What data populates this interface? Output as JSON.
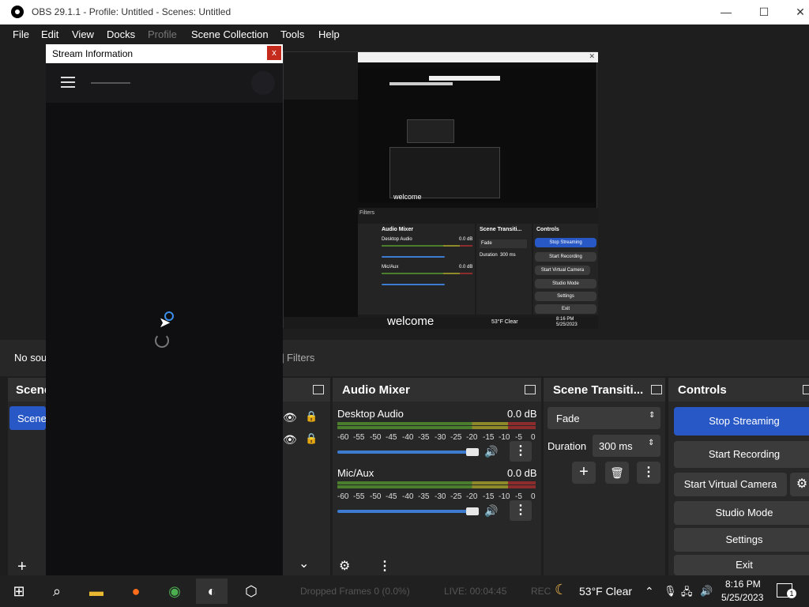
{
  "window": {
    "title": "OBS 29.1.1 - Profile: Untitled - Scenes: Untitled",
    "min": "—",
    "max": "☐",
    "close": "✕"
  },
  "menu": {
    "file": "File",
    "edit": "Edit",
    "view": "View",
    "docks": "Docks",
    "profile": "Profile",
    "scene_collection": "Scene Collection",
    "tools": "Tools",
    "help": "Help"
  },
  "preview": {
    "welcome": "welcome",
    "mini_audio_mixer": "Audio Mixer",
    "mini_scene_trans": "Scene Transiti...",
    "mini_controls": "Controls",
    "mini_desktop_audio": "Desktop Audio",
    "mini_mic": "Mic/Aux",
    "mini_db": "0.0 dB",
    "mini_fade": "Fade",
    "mini_duration": "Duration",
    "mini_ms": "300 ms",
    "mini_stop": "Stop Streaming",
    "mini_start_rec": "Start Recording",
    "mini_virtual": "Start Virtual Camera",
    "mini_studio": "Studio Mode",
    "mini_settings": "Settings",
    "mini_exit": "Exit",
    "mini_filters": "Filters",
    "mini_weather": "53°F Clear",
    "mini_time": "8:16 PM",
    "mini_date": "5/25/2023"
  },
  "sources_bar": {
    "no_source": "No sou",
    "filters": "Filters"
  },
  "scenes": {
    "title": "Scene",
    "item": "Scene"
  },
  "audio_mixer": {
    "title": "Audio Mixer",
    "tracks": [
      {
        "name": "Desktop Audio",
        "db": "0.0 dB",
        "volume": 1.0
      },
      {
        "name": "Mic/Aux",
        "db": "0.0 dB",
        "volume": 1.0
      }
    ],
    "ticks": [
      "-60",
      "-55",
      "-50",
      "-45",
      "-40",
      "-35",
      "-30",
      "-25",
      "-20",
      "-15",
      "-10",
      "-5",
      "0"
    ]
  },
  "scene_transitions": {
    "title": "Scene Transiti...",
    "transition": "Fade",
    "duration_label": "Duration",
    "duration_value": "300 ms"
  },
  "controls": {
    "title": "Controls",
    "stop_streaming": "Stop Streaming",
    "start_recording": "Start Recording",
    "start_virtual_camera": "Start Virtual Camera",
    "studio_mode": "Studio Mode",
    "settings": "Settings",
    "exit": "Exit"
  },
  "status": {
    "dropped": "Dropped Frames 0 (0.0%)",
    "live": "LIVE: 00:04:45",
    "rec": "REC"
  },
  "dialog": {
    "title": "Stream Information",
    "close": "x"
  },
  "taskbar": {
    "weather": "53°F  Clear",
    "time": "8:16 PM",
    "date": "5/25/2023",
    "notifications": "1"
  }
}
